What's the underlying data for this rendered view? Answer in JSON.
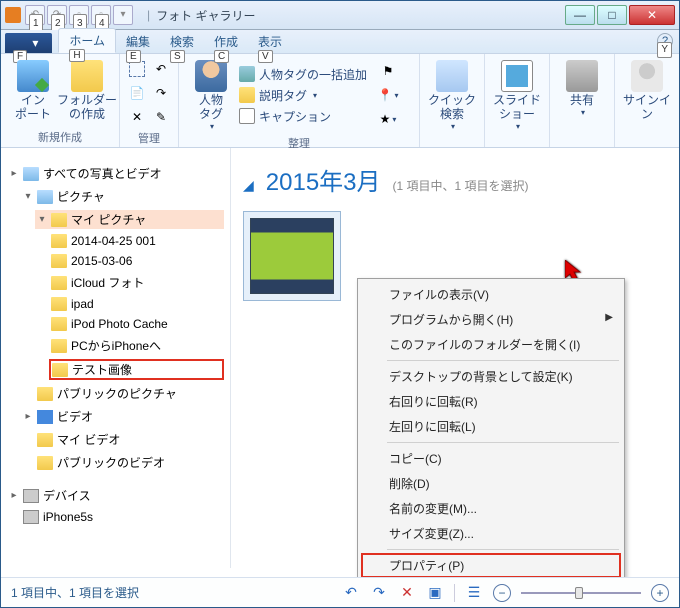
{
  "window": {
    "title": "フォト ギャラリー",
    "qat_keys": [
      "1",
      "2",
      "3",
      "4"
    ],
    "help_key": "Y"
  },
  "file_tab": {
    "key": "F"
  },
  "tabs": [
    {
      "label": "ホーム",
      "key": "H",
      "active": true
    },
    {
      "label": "編集",
      "key": "E"
    },
    {
      "label": "検索",
      "key": "S"
    },
    {
      "label": "作成",
      "key": "C"
    },
    {
      "label": "表示",
      "key": "V"
    }
  ],
  "ribbon": {
    "group_new": {
      "import": "イン\nポート",
      "folder_create": "フォルダー\nの作成",
      "label": "新規作成"
    },
    "group_manage": {
      "label": "管理"
    },
    "group_organize": {
      "people_tag": "人物\nタグ",
      "people_tag_batch": "人物タグの一括追加",
      "desc_tag": "説明タグ",
      "caption": "キャプション",
      "label": "整理"
    },
    "group_quick": {
      "quick_search": "クイック\n検索",
      "slideshow": "スライド\nショー",
      "share": "共有",
      "signin": "サインイン"
    }
  },
  "tree": {
    "root": "すべての写真とビデオ",
    "pictures": "ピクチャ",
    "my_pictures": "マイ ピクチャ",
    "children": [
      "2014-04-25 001",
      "2015-03-06",
      "iCloud フォト",
      "ipad",
      "iPod Photo Cache",
      "PCからiPhoneへ",
      "テスト画像"
    ],
    "public_pictures": "パブリックのピクチャ",
    "videos": "ビデオ",
    "my_videos": "マイ ビデオ",
    "public_videos": "パブリックのビデオ",
    "devices": "デバイス",
    "device1": "iPhone5s"
  },
  "content": {
    "month": "2015年3月",
    "count_text": "(1 項目中、1 項目を選択)"
  },
  "context_menu": [
    {
      "label": "ファイルの表示(V)"
    },
    {
      "label": "プログラムから開く(H)",
      "submenu": true
    },
    {
      "label": "このファイルのフォルダーを開く(I)"
    },
    {
      "sep": true
    },
    {
      "label": "デスクトップの背景として設定(K)"
    },
    {
      "label": "右回りに回転(R)"
    },
    {
      "label": "左回りに回転(L)"
    },
    {
      "sep": true
    },
    {
      "label": "コピー(C)"
    },
    {
      "label": "削除(D)"
    },
    {
      "label": "名前の変更(M)..."
    },
    {
      "label": "サイズ変更(Z)..."
    },
    {
      "sep": true
    },
    {
      "label": "プロパティ(P)",
      "highlighted": true
    }
  ],
  "statusbar": {
    "text": "1 項目中、1 項目を選択"
  }
}
